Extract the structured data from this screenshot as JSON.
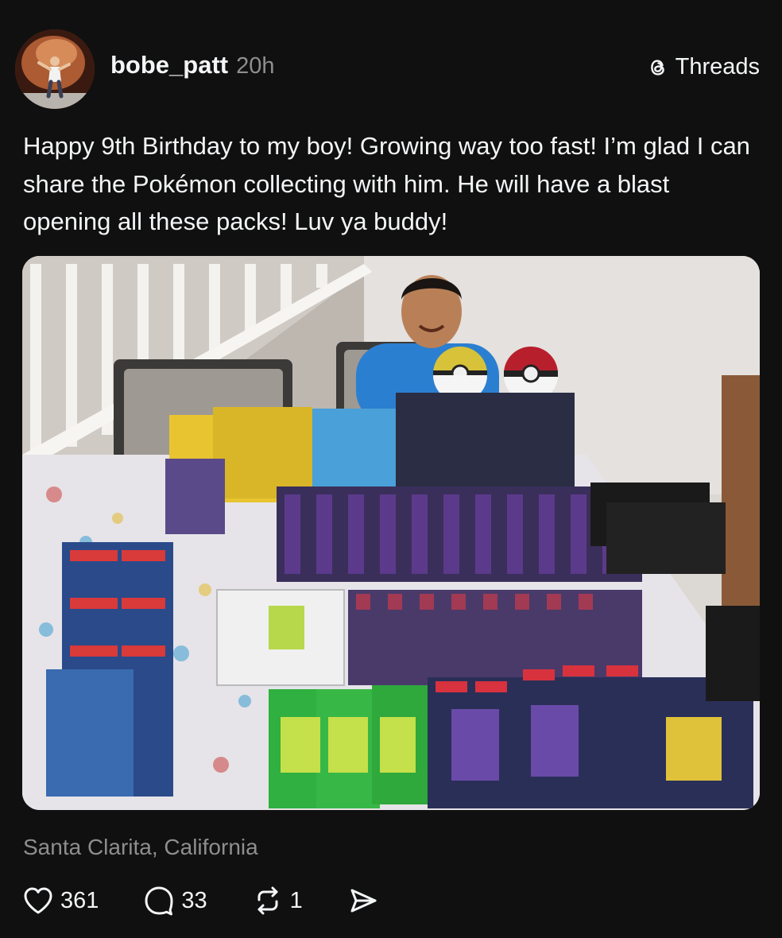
{
  "post": {
    "username": "bobe_patt",
    "timestamp": "20h",
    "brand": "Threads",
    "caption": "Happy 9th Birthday to my boy! Growing way too fast! I’m glad I can share the Pokémon collecting with him. He will have a blast opening all these packs! Luv ya buddy!",
    "location": "Santa Clarita, California",
    "stats": {
      "likes": "361",
      "replies": "33",
      "reposts": "1"
    }
  },
  "icons": {
    "like": "heart-icon",
    "reply": "speech-bubble-icon",
    "repost": "repost-arrows-icon",
    "share": "send-icon",
    "brand": "threads-logo-icon"
  },
  "colors": {
    "background": "#101010",
    "primary_text": "#f3f5f7",
    "secondary_text": "#8e8e8e"
  }
}
